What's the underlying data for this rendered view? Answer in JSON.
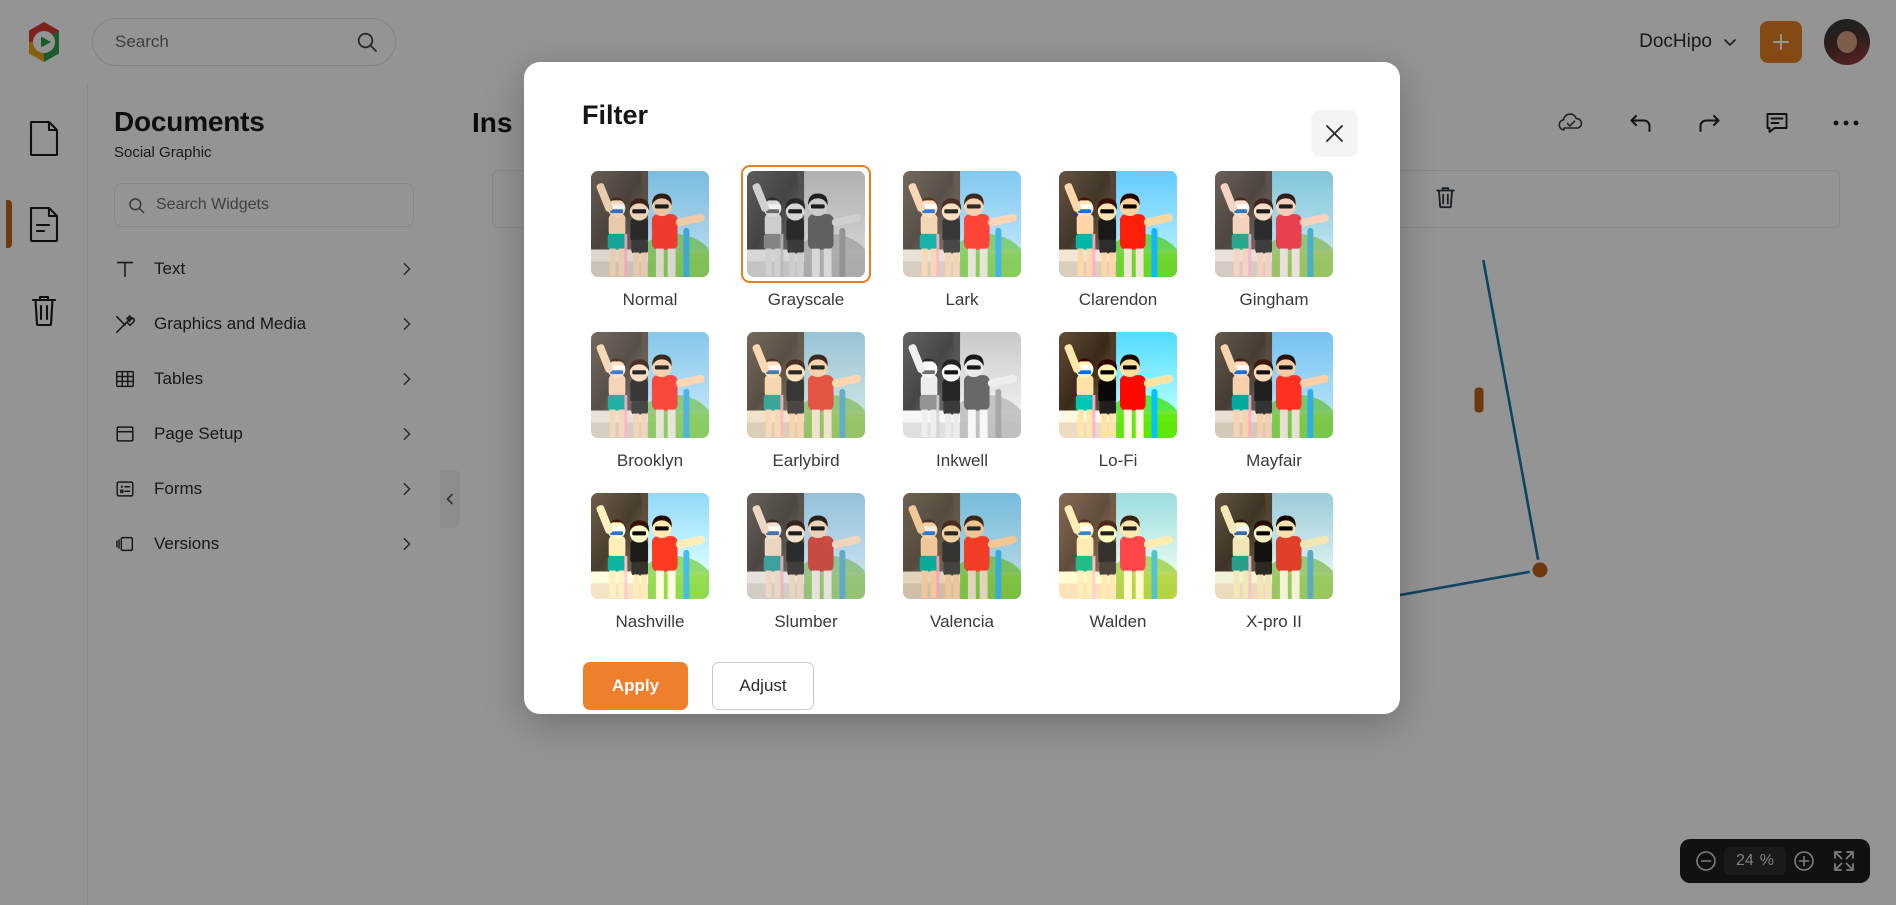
{
  "topbar": {
    "logo_icon": "dochipo-logo-icon",
    "search_placeholder": "Search",
    "search_value": "",
    "search_icon": "search-icon",
    "org_name": "DocHipo",
    "org_chevron_icon": "chevron-down-icon",
    "add_icon": "plus-icon",
    "avatar_icon": "user-avatar"
  },
  "rail": [
    {
      "name": "documents-page-icon",
      "icon": "document-outline-icon",
      "active": false
    },
    {
      "name": "pages-icon",
      "icon": "document-lines-icon",
      "active": true
    },
    {
      "name": "trash-icon",
      "icon": "trash-icon",
      "active": false
    }
  ],
  "panel": {
    "title": "Documents",
    "subtitle": "Social Graphic",
    "search_placeholder": "Search Widgets",
    "search_value": "",
    "search_icon": "search-icon",
    "items": [
      {
        "label": "Text",
        "icon": "text-t-icon"
      },
      {
        "label": "Graphics and Media",
        "icon": "graphics-media-icon"
      },
      {
        "label": "Tables",
        "icon": "table-grid-icon"
      },
      {
        "label": "Page Setup",
        "icon": "page-setup-icon"
      },
      {
        "label": "Forms",
        "icon": "forms-icon"
      },
      {
        "label": "Versions",
        "icon": "versions-icon"
      }
    ],
    "chevron_icon": "chevron-right-icon",
    "collapse_icon": "chevron-left-icon"
  },
  "editor": {
    "title": "Ins",
    "tools": [
      {
        "name": "cloud-saved-icon",
        "label": "cloud-check-icon"
      },
      {
        "name": "undo-icon",
        "label": "undo-arrow-icon"
      },
      {
        "name": "redo-icon",
        "label": "redo-arrow-icon"
      },
      {
        "name": "comment-icon",
        "label": "comment-icon"
      },
      {
        "name": "more-options-icon",
        "label": "ellipsis-icon"
      }
    ],
    "selection_delete_icon": "trash-icon",
    "shape_color": "#1878A8",
    "handle_color": "#C0631C"
  },
  "zoom": {
    "minus_icon": "zoom-out-icon",
    "value": "24",
    "unit": "%",
    "plus_icon": "zoom-in-icon",
    "fullscreen_icon": "fullscreen-icon"
  },
  "modal": {
    "title": "Filter",
    "close_icon": "close-icon",
    "selected_filter": "Grayscale",
    "accent_color": "#E67E22",
    "filters": [
      {
        "label": "Normal",
        "css": "none"
      },
      {
        "label": "Grayscale",
        "css": "grayscale(1)"
      },
      {
        "label": "Lark",
        "css": "contrast(0.9) brightness(1.1) saturate(1.1)"
      },
      {
        "label": "Clarendon",
        "css": "contrast(1.2) saturate(1.35)"
      },
      {
        "label": "Gingham",
        "css": "brightness(1.05) hue-rotate(-10deg) saturate(0.85)"
      },
      {
        "label": "Brooklyn",
        "css": "contrast(0.9) brightness(1.1)"
      },
      {
        "label": "Earlybird",
        "css": "sepia(0.25) contrast(0.9) brightness(1.05) saturate(1.1)"
      },
      {
        "label": "Inkwell",
        "css": "grayscale(1) brightness(1.1) contrast(1.1)"
      },
      {
        "label": "Lo-Fi",
        "css": "saturate(1.5) contrast(1.4)"
      },
      {
        "label": "Mayfair",
        "css": "contrast(1.1) saturate(1.1)"
      },
      {
        "label": "Nashville",
        "css": "sepia(0.2) contrast(1.2) brightness(1.05) saturate(1.2)"
      },
      {
        "label": "Slumber",
        "css": "saturate(0.66) brightness(1.05)"
      },
      {
        "label": "Valencia",
        "css": "sepia(0.15) saturate(1.5) contrast(0.9)"
      },
      {
        "label": "Walden",
        "css": "sepia(0.35) brightness(1.1) hue-rotate(-10deg) saturate(1.6)"
      },
      {
        "label": "X-pro II",
        "css": "sepia(0.3) contrast(1.3) brightness(0.95)"
      }
    ],
    "apply_label": "Apply",
    "adjust_label": "Adjust"
  }
}
